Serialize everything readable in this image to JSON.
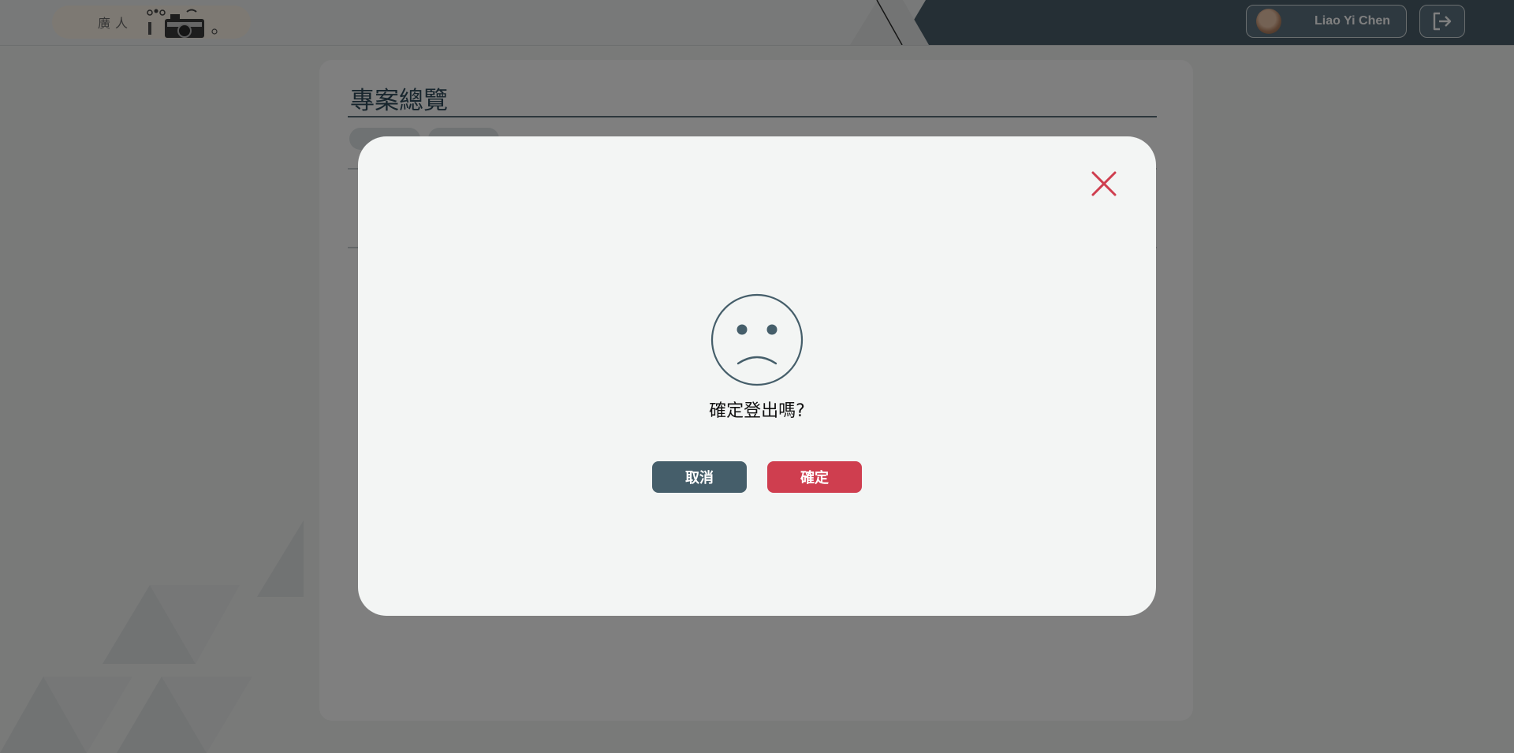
{
  "header": {
    "brand_text": "廣人",
    "user_name": "Liao Yi Chen"
  },
  "main": {
    "page_title": "專案總覽",
    "tabs": [
      {
        "label": ""
      },
      {
        "label": ""
      }
    ]
  },
  "modal": {
    "message": "確定登出嗎?",
    "cancel_label": "取消",
    "confirm_label": "確定"
  },
  "icons": {
    "close": "close-icon",
    "sad_face": "sad-face-icon",
    "logout": "logout-icon",
    "camera": "camera-icon"
  },
  "colors": {
    "primary_dark": "#455e6a",
    "accent_red": "#cf3e4f",
    "modal_bg": "#f3f5f4"
  }
}
